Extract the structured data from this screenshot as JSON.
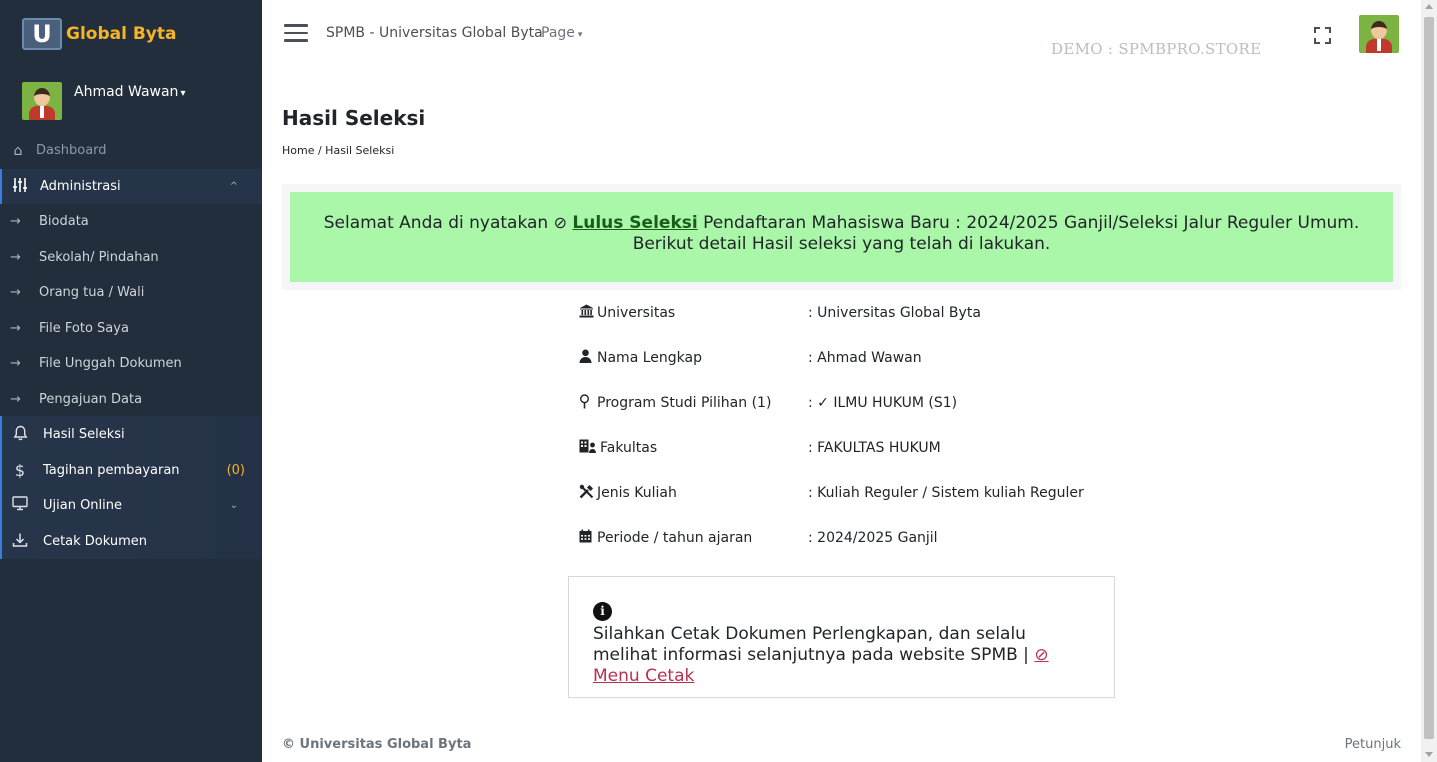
{
  "brand": {
    "logo_letter": "U",
    "name": "Global Byta"
  },
  "user": {
    "name": "Ahmad Wawan"
  },
  "sidebar": {
    "dashboard": "Dashboard",
    "admin": "Administrasi",
    "sub_items": [
      "Biodata",
      "Sekolah/ Pindahan",
      "Orang tua / Wali",
      "File Foto Saya",
      "File Unggah Dokumen",
      "Pengajuan Data"
    ],
    "hasil": "Hasil Seleksi",
    "tagihan": "Tagihan pembayaran",
    "tagihan_count": "(0)",
    "ujian": "Ujian Online",
    "cetak": "Cetak Dokumen"
  },
  "topbar": {
    "title": "SPMB - Universitas Global Byta",
    "page_menu": "Page",
    "watermark": "DEMO : SPMBPRO.STORE"
  },
  "main": {
    "title": "Hasil Seleksi",
    "breadcrumb": "Home / Hasil Seleksi",
    "alert": {
      "prefix": "Selamat Anda di nyatakan",
      "status": "Lulus Seleksi",
      "suffix": "Pendaftaran Mahasiswa Baru : 2024/2025 Ganjil/Seleksi Jalur Reguler Umum.",
      "line2": "Berikut detail Hasil seleksi yang telah di lakukan."
    },
    "details": [
      {
        "label": "Universitas",
        "value": ": Universitas Global Byta"
      },
      {
        "label": "Nama Lengkap",
        "value": ": Ahmad Wawan"
      },
      {
        "label": "Program Studi Pilihan (1)",
        "value": ": ✓ ILMU HUKUM (S1)"
      },
      {
        "label": "Fakultas",
        "value": ": FAKULTAS HUKUM"
      },
      {
        "label": "Jenis Kuliah",
        "value": ": Kuliah Reguler / Sistem kuliah Reguler"
      },
      {
        "label": "Periode / tahun ajaran",
        "value": ": 2024/2025 Ganjil"
      }
    ],
    "notice": {
      "text": "Silahkan Cetak Dokumen Perlengkapan, dan selalu melihat informasi selanjutnya pada website SPMB |",
      "link": "Menu Cetak"
    }
  },
  "footer": {
    "copyright": "© Universitas Global Byta",
    "help": "Petunjuk"
  }
}
